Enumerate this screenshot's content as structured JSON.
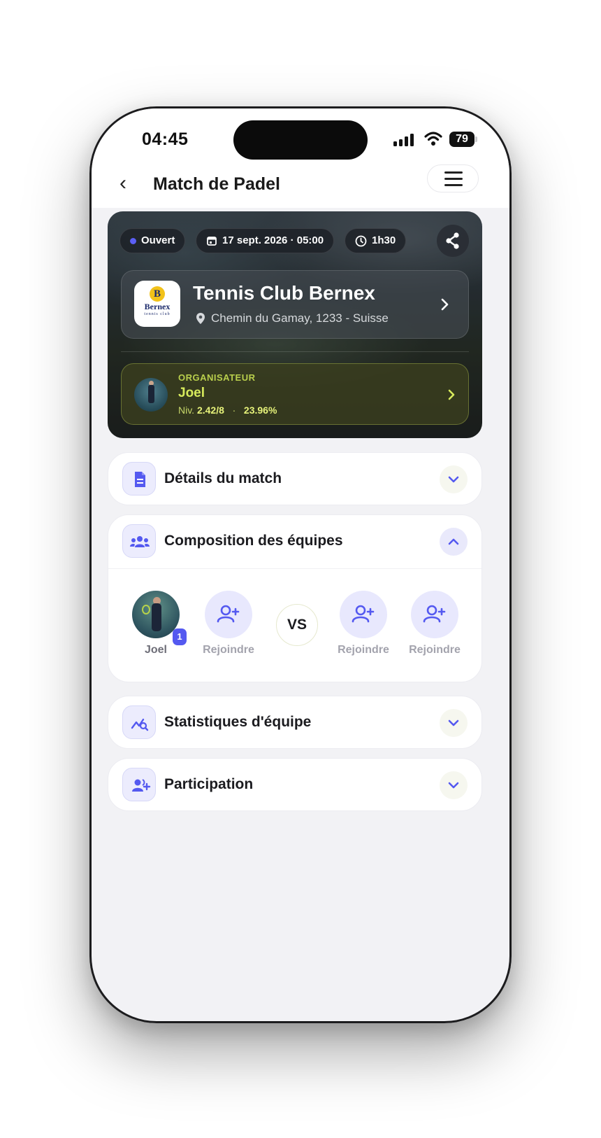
{
  "status_bar": {
    "time": "04:45",
    "battery": "79"
  },
  "nav": {
    "back_glyph": "‹",
    "title": "Match de Padel"
  },
  "hero": {
    "status_chip": "Ouvert",
    "date_chip": "17 sept. 2026 · 05:00",
    "duration_chip": "1h30",
    "club": {
      "logo_letter": "B",
      "logo_name": "Bernex",
      "logo_sub": "tennis club",
      "name": "Tennis Club Bernex",
      "address": "Chemin du Gamay, 1233 - Suisse"
    },
    "organizer": {
      "label": "ORGANISATEUR",
      "name": "Joel",
      "level_prefix": "Niv.",
      "level": "2.42/8",
      "separator": "·",
      "percent": "23.96%"
    }
  },
  "sections": {
    "details": {
      "title": "Détails du match"
    },
    "teams": {
      "title": "Composition des équipes",
      "vs": "VS",
      "slots": [
        {
          "label": "Joel",
          "badge": "1"
        },
        {
          "label": "Rejoindre"
        },
        {
          "label": "Rejoindre"
        },
        {
          "label": "Rejoindre"
        }
      ]
    },
    "stats": {
      "title": "Statistiques d'équipe"
    },
    "participation": {
      "title": "Participation"
    }
  },
  "colors": {
    "accent": "#5459f0",
    "organizer_accent": "#d7ea5c",
    "background": "#f2f2f5"
  },
  "icons": [
    "back-chevron-icon",
    "menu-icon",
    "share-icon",
    "calendar-icon",
    "clock-icon",
    "location-pin-icon",
    "document-icon",
    "team-icon",
    "stats-search-icon",
    "user-plus-icon",
    "chevron-down-icon",
    "chevron-up-icon",
    "chevron-right-icon"
  ]
}
